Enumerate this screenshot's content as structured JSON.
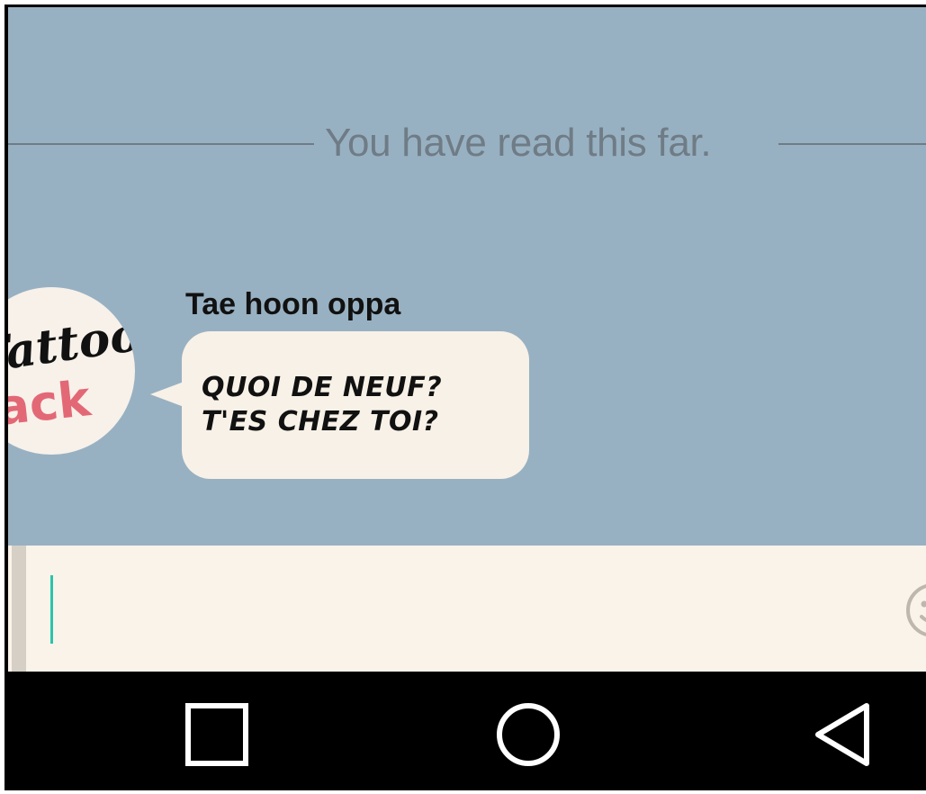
{
  "chat": {
    "read_marker": "You have read this far.",
    "messages": [
      {
        "sender": "Tae hoon oppa",
        "avatar_text": [
          "Tattoo",
          "Jack"
        ],
        "lines": [
          "QUOI DE NEUF?",
          "T'ES CHEZ TOI?"
        ]
      }
    ]
  },
  "input": {
    "value": "",
    "emoji_icon": "emoji-icon"
  },
  "nav": {
    "recents_icon": "square-icon",
    "home_icon": "circle-icon",
    "back_icon": "triangle-back-icon"
  },
  "colors": {
    "chat_background": "#98b1c2",
    "bubble": "#f8f1e7",
    "input_background": "#faf3ea",
    "cursor": "#2bc4a8",
    "nav_background": "#000000",
    "divider": "#6f7c86"
  }
}
